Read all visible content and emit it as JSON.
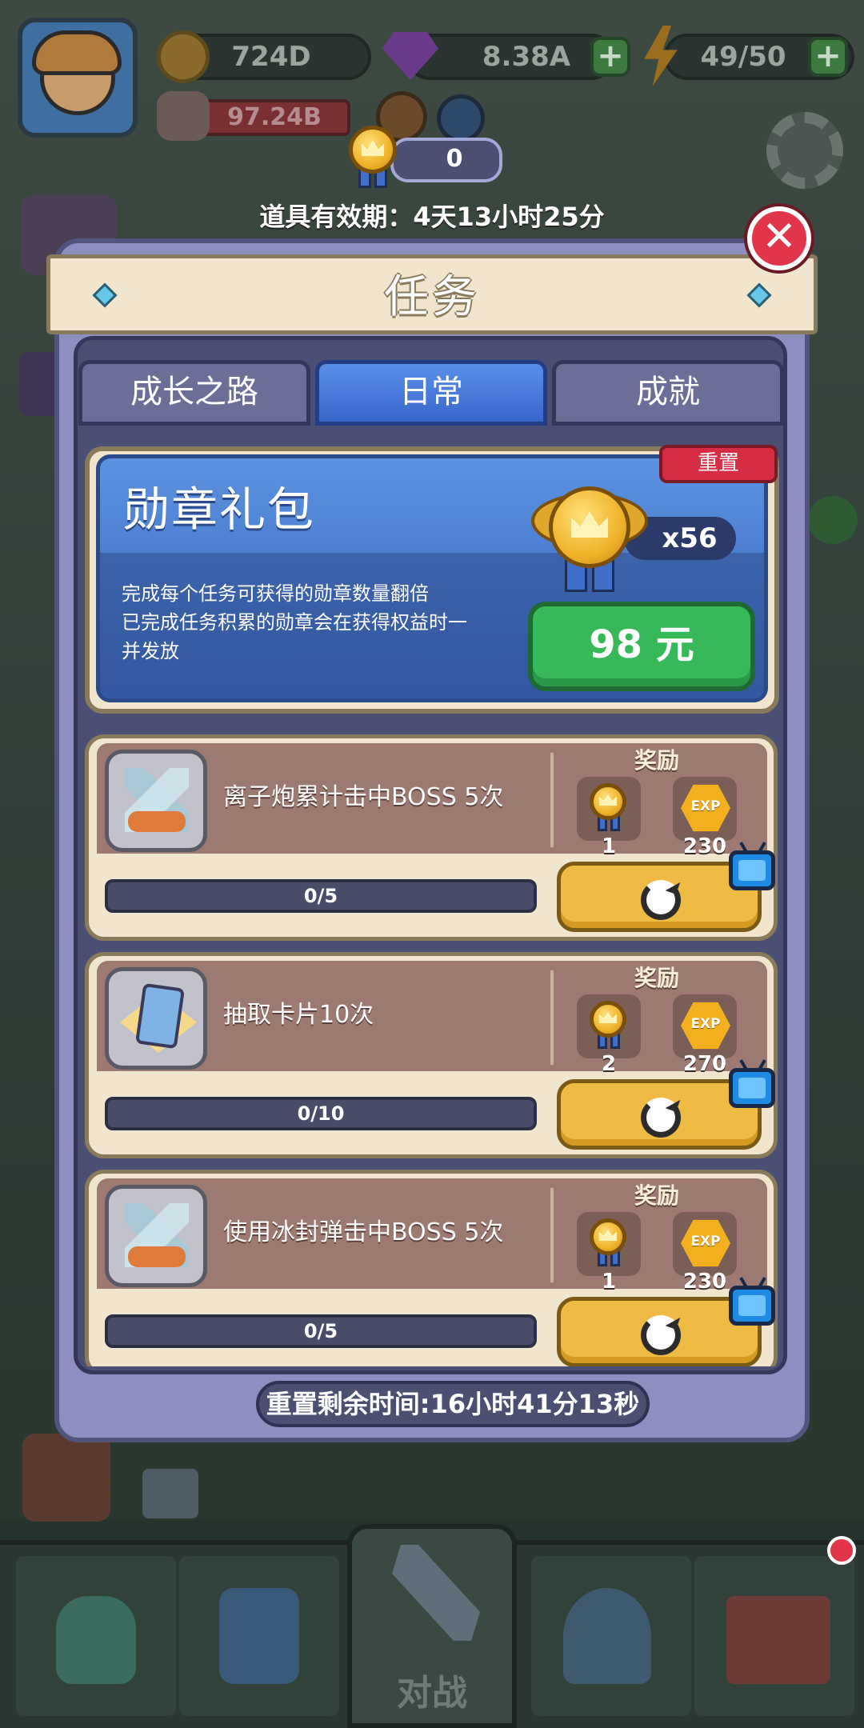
{
  "top_bar": {
    "coins": "724D",
    "gems": "8.38A",
    "energy": "49/50",
    "power": "97.24B"
  },
  "medal_counter": "0",
  "validity_text": "道具有效期：4天13小时25分",
  "dialog": {
    "title": "任务",
    "tabs": [
      {
        "label": "成长之路",
        "active": false
      },
      {
        "label": "日常",
        "active": true
      },
      {
        "label": "成就",
        "active": false
      }
    ]
  },
  "medal_pack": {
    "title": "勋章礼包",
    "reset_label": "重置",
    "desc_line1": "完成每个任务可获得的勋章数量翻倍",
    "desc_line2": "已完成任务积累的勋章会在获得权益时一",
    "desc_line3": "并发放",
    "medal_count": "x56",
    "price": "98 元"
  },
  "tasks": [
    {
      "label": "离子炮累计击中BOSS 5次",
      "reward_title": "奖励",
      "medal_reward": "1",
      "exp_label": "EXP",
      "exp_reward": "230",
      "progress_text": "0/5",
      "progress": 0,
      "icon": "crossed-swords-icon"
    },
    {
      "label": "抽取卡片10次",
      "reward_title": "奖励",
      "medal_reward": "2",
      "exp_label": "EXP",
      "exp_reward": "270",
      "progress_text": "0/10",
      "progress": 0,
      "icon": "cards-icon"
    },
    {
      "label": "使用冰封弹击中BOSS 5次",
      "reward_title": "奖励",
      "medal_reward": "1",
      "exp_label": "EXP",
      "exp_reward": "230",
      "progress_text": "0/5",
      "progress": 0,
      "icon": "crossed-swords-icon"
    }
  ],
  "reset_timer": "重置剩余时间:16小时41分13秒",
  "bottom_nav": {
    "center_label": "对战"
  },
  "colors": {
    "dialog_bg": "#8c8fbf",
    "tab_active": "#3e6fd3",
    "buy_button": "#37b95a",
    "go_button": "#f0bb45",
    "close_button": "#e2354a"
  }
}
